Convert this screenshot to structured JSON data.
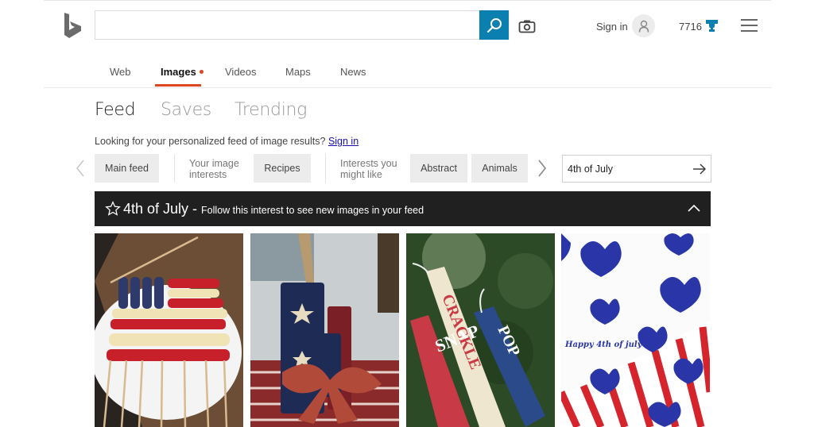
{
  "header": {
    "logo": "bing-logo",
    "search": {
      "value": "",
      "placeholder": ""
    },
    "sign_in_label": "Sign in",
    "rewards_points": "7716",
    "accent_color": "#0c7fb1"
  },
  "nav": {
    "items": [
      {
        "label": "Web",
        "active": false
      },
      {
        "label": "Images",
        "active": true
      },
      {
        "label": "Videos",
        "active": false
      },
      {
        "label": "Maps",
        "active": false
      },
      {
        "label": "News",
        "active": false
      }
    ],
    "active_color": "#e0461e"
  },
  "feed_tabs": [
    {
      "label": "Feed",
      "active": true
    },
    {
      "label": "Saves",
      "active": false
    },
    {
      "label": "Trending",
      "active": false
    }
  ],
  "prompt": {
    "text": "Looking for your personalized feed of image results?",
    "link": "Sign in"
  },
  "filters": {
    "main_feed": "Main feed",
    "your_interests_label": "Your image interests",
    "your_interests_line1": "Your image",
    "your_interests_line2": "interests",
    "your_interests": [
      "Recipes"
    ],
    "suggested_label_line1": "Interests you",
    "suggested_label_line2": "might like",
    "suggested": [
      "Abstract",
      "Animals"
    ],
    "interest_input": {
      "value": "4th of July",
      "placeholder": ""
    }
  },
  "banner": {
    "title": "4th of July",
    "dash": "-",
    "subtitle": "Follow this interest to see new images in your feed"
  },
  "images": [
    {
      "description": "Fruit skewers arranged as American flag with blueberries, bananas and strawberries on white plate"
    },
    {
      "description": "Painted wooden firecracker decorations with stars and gingham bow"
    },
    {
      "description": "Firecracker candles labeled SNAP, CRACKLE, POP"
    },
    {
      "description": "Blue star-patterned hearts over red and white stripes",
      "caption": "Happy 4th of july"
    }
  ]
}
